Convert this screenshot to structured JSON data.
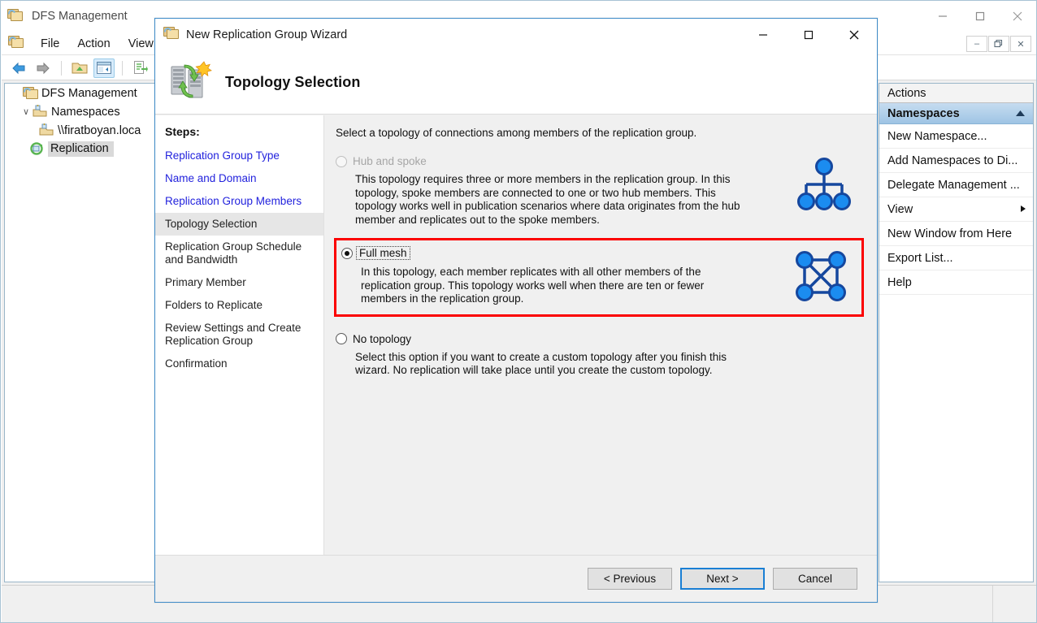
{
  "mmc": {
    "title": "DFS Management",
    "title_icon": "dfs-folder-icon",
    "menus": [
      "File",
      "Action",
      "View"
    ],
    "window_buttons": {
      "minimize": "—",
      "maximize": "□",
      "close": "✕"
    },
    "doc_buttons": {
      "minimize": "–",
      "restore": "❐",
      "close": "✕"
    },
    "toolbar": [
      {
        "name": "back-button",
        "icon": "left-arrow-icon"
      },
      {
        "name": "forward-button",
        "icon": "right-arrow-icon"
      },
      {
        "name": "up-folder-button",
        "icon": "up-folder-icon"
      },
      {
        "name": "show-hide-tree-button",
        "icon": "console-tree-icon",
        "selected": true
      },
      {
        "name": "properties-button",
        "icon": "properties-icon"
      },
      {
        "name": "refresh-button",
        "icon": "refresh-icon"
      }
    ],
    "tree": [
      {
        "label": "DFS Management",
        "icon": "dfs-folder-icon",
        "indent": 0,
        "chevron": "",
        "selected": false
      },
      {
        "label": "Namespaces",
        "icon": "namespace-icon",
        "indent": 1,
        "chevron": "∨",
        "selected": false
      },
      {
        "label": "\\\\firatboyan.loca",
        "icon": "namespace-icon",
        "indent": 2,
        "chevron": "",
        "selected": false
      },
      {
        "label": "Replication",
        "icon": "replication-icon",
        "indent": 1,
        "chevron": "",
        "selected": true
      }
    ],
    "actions": {
      "header": "Actions",
      "group": "Namespaces",
      "group_collapse_icon": "chevron-up-icon",
      "items": [
        {
          "label": "New Namespace...",
          "submenu": false
        },
        {
          "label": "Add Namespaces to Di...",
          "submenu": false
        },
        {
          "label": "Delegate Management ...",
          "submenu": false
        },
        {
          "label": "View",
          "submenu": true
        },
        {
          "label": "New Window from Here",
          "submenu": false
        },
        {
          "label": "Export List...",
          "submenu": false
        },
        {
          "label": "Help",
          "submenu": false
        }
      ]
    }
  },
  "wizard": {
    "window_title": "New Replication Group Wizard",
    "window_icon": "dfs-folder-icon",
    "header_title": "Topology Selection",
    "header_icon": "replication-servers-icon",
    "window_buttons": {
      "minimize": "—",
      "maximize": "□",
      "close": "✕"
    },
    "steps_title": "Steps:",
    "steps": [
      {
        "label": "Replication Group Type",
        "state": "completed"
      },
      {
        "label": "Name and Domain",
        "state": "completed"
      },
      {
        "label": "Replication Group Members",
        "state": "completed"
      },
      {
        "label": "Topology Selection",
        "state": "current"
      },
      {
        "label": "Replication Group Schedule and Bandwidth",
        "state": "pending"
      },
      {
        "label": "Primary Member",
        "state": "pending"
      },
      {
        "label": "Folders to Replicate",
        "state": "pending"
      },
      {
        "label": "Review Settings and Create Replication Group",
        "state": "pending"
      },
      {
        "label": "Confirmation",
        "state": "pending"
      }
    ],
    "intro": "Select a topology of connections among members of the replication group.",
    "options": [
      {
        "id": "hub-and-spoke",
        "label": "Hub and spoke",
        "description": "This topology requires three or more members in the replication group. In this topology, spoke members are connected to one or two hub members. This topology works well in publication scenarios where data originates from the hub member and replicates out to the spoke members.",
        "selected": false,
        "disabled": true,
        "icon": "hub-and-spoke-topology-icon"
      },
      {
        "id": "full-mesh",
        "label": "Full mesh",
        "description": "In this topology, each member replicates with all other members of the replication group. This topology works well when there are ten or fewer members in the replication group.",
        "selected": true,
        "disabled": false,
        "focused": true,
        "highlighted": true,
        "icon": "full-mesh-topology-icon"
      },
      {
        "id": "no-topology",
        "label": "No topology",
        "description": "Select this option if you want to create a custom topology after you finish this wizard. No replication will take place until you create the custom topology.",
        "selected": false,
        "disabled": false,
        "icon": null
      }
    ],
    "buttons": {
      "previous": "< Previous",
      "next": "Next >",
      "cancel": "Cancel"
    }
  },
  "colors": {
    "highlight_red": "#fb0000",
    "link_blue": "#2222dd",
    "node_blue": "#1b8cf0",
    "node_stroke": "#15479e",
    "dialog_border": "#3f8cc9",
    "default_button_border": "#1a7fd4"
  }
}
